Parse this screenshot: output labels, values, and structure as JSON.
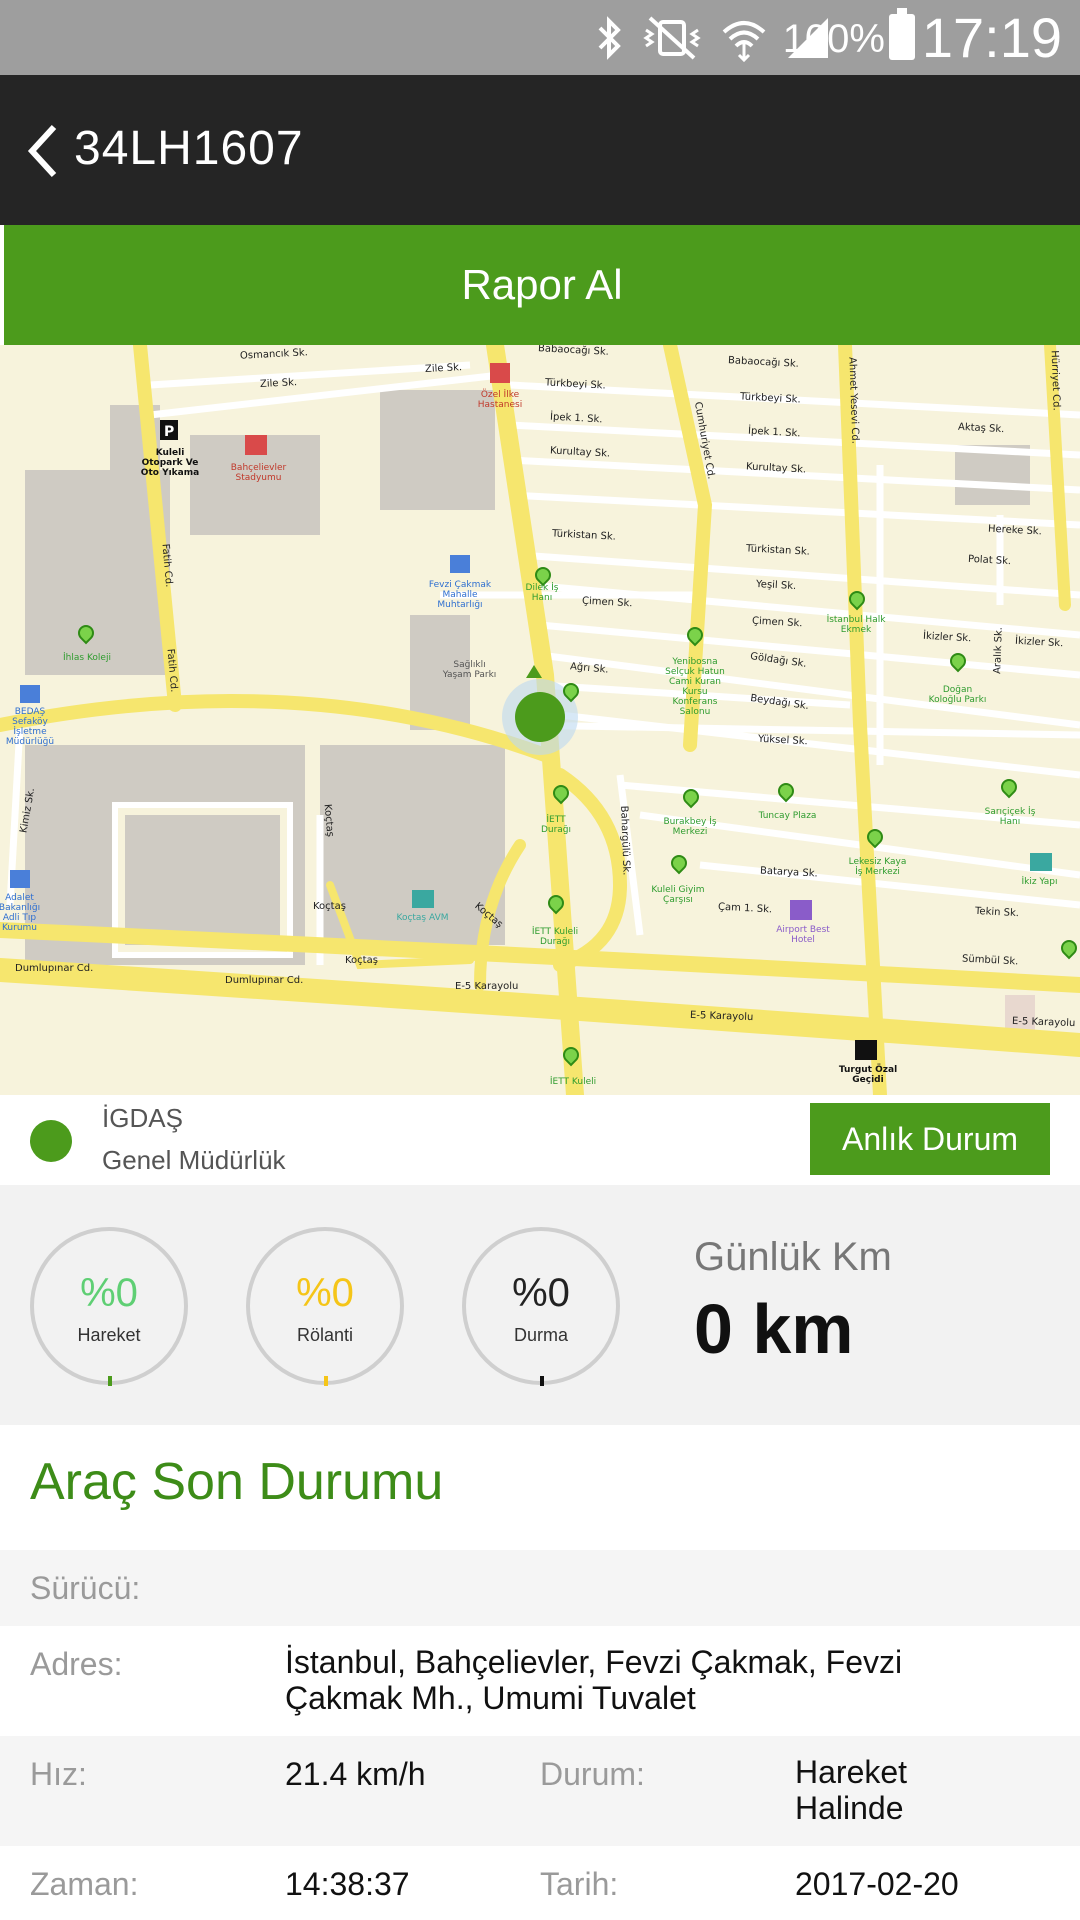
{
  "status_bar": {
    "battery": "100%",
    "time": "17:19",
    "icons": [
      "bluetooth-icon",
      "vibrate-icon",
      "wifi-icon",
      "signal-icon",
      "battery-icon"
    ]
  },
  "app_bar": {
    "title": "34LH1607"
  },
  "report_button": {
    "label": "Rapor Al"
  },
  "map": {
    "streets": [
      "Osmancık Sk.",
      "Zile Sk.",
      "Zile Sk.",
      "Babaocağı Sk.",
      "Babaocağı Sk.",
      "Türkbeyi Sk.",
      "Türkbeyi Sk.",
      "İpek 1. Sk.",
      "İpek 1. Sk.",
      "Kurultay Sk.",
      "Kurultay Sk.",
      "Aktaş Sk.",
      "Türkistan Sk.",
      "Türkistan Sk.",
      "Hereke Sk.",
      "Polat Sk.",
      "Yeşil Sk.",
      "Çimen Sk.",
      "Çimen Sk.",
      "İkizler Sk.",
      "İkizler Sk.",
      "Göldağı Sk.",
      "Ağrı Sk.",
      "Beydağı Sk.",
      "Yüksel Sk.",
      "Batarya Sk.",
      "Çam 1. Sk.",
      "Tekin Sk.",
      "Sümbül Sk.",
      "Koçtaş",
      "Koçtaş",
      "Koçtaş",
      "Koçtaş",
      "Dumlupınar Cd.",
      "Dumlupınar Cd.",
      "E-5 Karayolu",
      "E-5 Karayolu",
      "E-5 Karayolu",
      "Fatih Cd.",
      "Fatih Cd.",
      "Cumhuriyet Cd.",
      "Ahmet Yesevi Cd.",
      "Hürriyet Cd.",
      "Bahargülü Sk.",
      "Kimiz Sk.",
      "Aralık Sk."
    ],
    "pois": [
      "Kuleli Otopark Ve Oto Yıkama",
      "Bahçelievler Stadyumu",
      "Özel İlke Hastanesi",
      "Fevzi Çakmak Mahalle Muhtarlığı",
      "Sağlıklı Yaşam Parkı",
      "İhlas Koleji",
      "BEDAŞ Sefaköy İşletme Müdürlüğü",
      "Dilek İş Hanı",
      "İstanbul Halk Ekmek",
      "Yenibosna Selçuk Hatun Cami Kuran Kursu Konferans Salonu",
      "Doğan Koloğlu Parkı",
      "İETT Durağı",
      "Burakbey İş Merkezi",
      "Tuncay Plaza",
      "Sarıçiçek İş Hanı",
      "Lekesiz Kaya İş Merkezi",
      "Kuleli Giyim Çarşısı",
      "Airport Best Hotel",
      "Adalet Bakanlığı Adli Tıp Kurumu",
      "Koçtaş AVM",
      "İETT Kuleli Durağı",
      "İkiz Yapı",
      "Turgut Özal Geçidi",
      "İETT Kuleli"
    ]
  },
  "vehicle": {
    "company": "İGDAŞ",
    "department": "Genel Müdürlük",
    "instant_button": "Anlık Durum"
  },
  "stats": {
    "gauges": [
      {
        "value": "%0",
        "label": "Hareket",
        "color": "#5fcf74",
        "tick": "#4c9b1c"
      },
      {
        "value": "%0",
        "label": "Rölanti",
        "color": "#f5c518",
        "tick": "#f5c518"
      },
      {
        "value": "%0",
        "label": "Durma",
        "color": "#222222",
        "tick": "#111111"
      }
    ],
    "daily_km_title": "Günlük Km",
    "daily_km_value": "0 km"
  },
  "last_status": {
    "title": "Araç Son Durumu",
    "driver_label": "Sürücü:",
    "driver_value": "",
    "address_label": "Adres:",
    "address_value": "İstanbul, Bahçelievler, Fevzi Çakmak, Fevzi Çakmak Mh., Umumi Tuvalet",
    "speed_label": "Hız:",
    "speed_value": "21.4 km/h",
    "state_label": "Durum:",
    "state_value": "Hareket Halinde",
    "time_label": "Zaman:",
    "time_value": "14:38:37",
    "date_label": "Tarih:",
    "date_value": "2017-02-20"
  },
  "colors": {
    "accent": "#4c9b1c",
    "title_green": "#3d8c18",
    "app_bar": "#252525",
    "status_bar": "#9e9e9e"
  }
}
